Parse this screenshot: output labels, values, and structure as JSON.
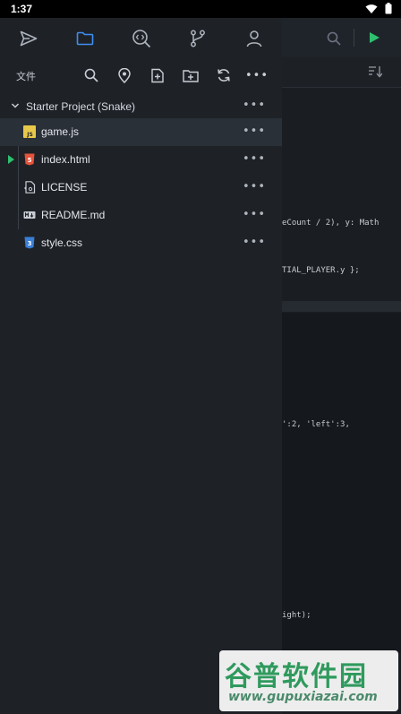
{
  "status_bar": {
    "time": "1:37"
  },
  "drawer": {
    "nav_tabs": [
      {
        "name": "send-icon",
        "active": false
      },
      {
        "name": "folder-icon",
        "active": true
      },
      {
        "name": "search-code-icon",
        "active": false
      },
      {
        "name": "git-branch-icon",
        "active": false
      },
      {
        "name": "account-icon",
        "active": false
      }
    ],
    "files_header": {
      "title": "文件",
      "actions": [
        "search-icon",
        "location-pin-icon",
        "new-file-icon",
        "new-folder-icon",
        "refresh-icon",
        "more-icon"
      ]
    },
    "project": {
      "label": "Starter Project (Snake)",
      "expanded": true
    },
    "files": [
      {
        "name": "game.js",
        "icon": "javascript-file-icon",
        "selected": true,
        "running": false
      },
      {
        "name": "index.html",
        "icon": "html-file-icon",
        "selected": false,
        "running": true
      },
      {
        "name": "LICENSE",
        "icon": "license-file-icon",
        "selected": false,
        "running": false
      },
      {
        "name": "README.md",
        "icon": "markdown-file-icon",
        "selected": false,
        "running": false
      },
      {
        "name": "style.css",
        "icon": "css-file-icon",
        "selected": false,
        "running": false
      }
    ],
    "more_glyph": "•••"
  },
  "editor": {
    "code_lines": [
      {
        "text": "eCount / 2), y: Math"
      },
      {
        "text": "TIAL_PLAYER.y };"
      },
      {
        "text": "':2, 'left':3,"
      },
      {
        "text": "ight);"
      }
    ]
  },
  "watermark": {
    "main": "谷普软件园",
    "url": "www.gupuxiazai.com"
  },
  "colors": {
    "accent_blue": "#3d8ef0",
    "run_green": "#2fbf6f",
    "js_yellow": "#e8c84a",
    "html_orange": "#e5533a",
    "css_blue": "#3a7fd6"
  }
}
